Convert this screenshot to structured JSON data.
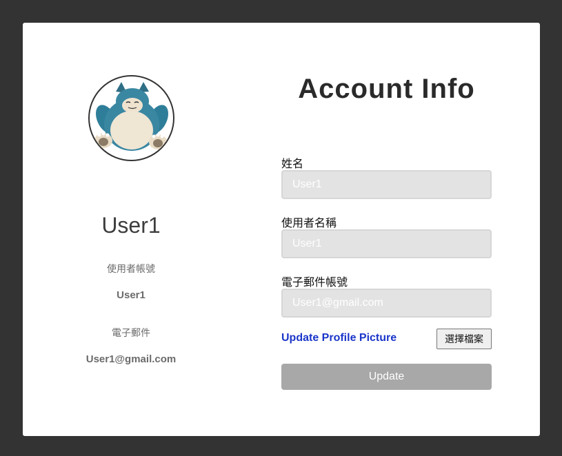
{
  "profile": {
    "display_name": "User1",
    "username_label": "使用者帳號",
    "username_value": "User1",
    "email_label": "電子郵件",
    "email_value": "User1@gmail.com",
    "avatar_icon": "snorlax-avatar-icon"
  },
  "form": {
    "title": "Account Info",
    "name_label": "姓名",
    "name_value": "User1",
    "username_label": "使用者名稱",
    "username_value": "User1",
    "email_label": "電子郵件帳號",
    "email_value": "User1@gmail.com",
    "upload_link_label": "Update Profile Picture",
    "file_button_label": "選擇檔案",
    "submit_label": "Update"
  },
  "colors": {
    "page_background": "#333333",
    "card_background": "#ffffff",
    "input_background": "#e3e3e3",
    "link": "#1a35c9",
    "submit_button": "#a8a8a8"
  }
}
